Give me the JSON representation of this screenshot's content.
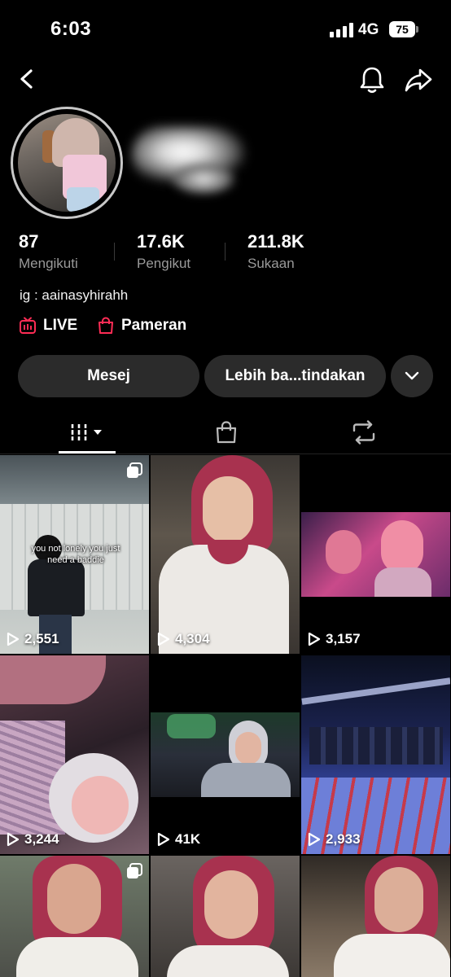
{
  "status_bar": {
    "time": "6:03",
    "network": "4G",
    "battery": "75"
  },
  "profile": {
    "stats": [
      {
        "value": "87",
        "label": "Mengikuti"
      },
      {
        "value": "17.6K",
        "label": "Pengikut"
      },
      {
        "value": "211.8K",
        "label": "Sukaan"
      }
    ],
    "bio": "ig : aainasyhirahh",
    "links": {
      "live": "LIVE",
      "showcase": "Pameran"
    }
  },
  "actions": {
    "message": "Mesej",
    "more": "Lebih ba...tindakan"
  },
  "videos": [
    {
      "views": "2,551",
      "caption": "you not lonely you just need a baddie"
    },
    {
      "views": "4,304"
    },
    {
      "views": "3,157"
    },
    {
      "views": "3,244"
    },
    {
      "views": "41K"
    },
    {
      "views": "2,933"
    },
    {
      "views": ""
    },
    {
      "views": ""
    },
    {
      "views": ""
    }
  ],
  "colors": {
    "accent_red": "#fe2c55",
    "button_bg": "#2b2b2b",
    "background": "#000000"
  }
}
